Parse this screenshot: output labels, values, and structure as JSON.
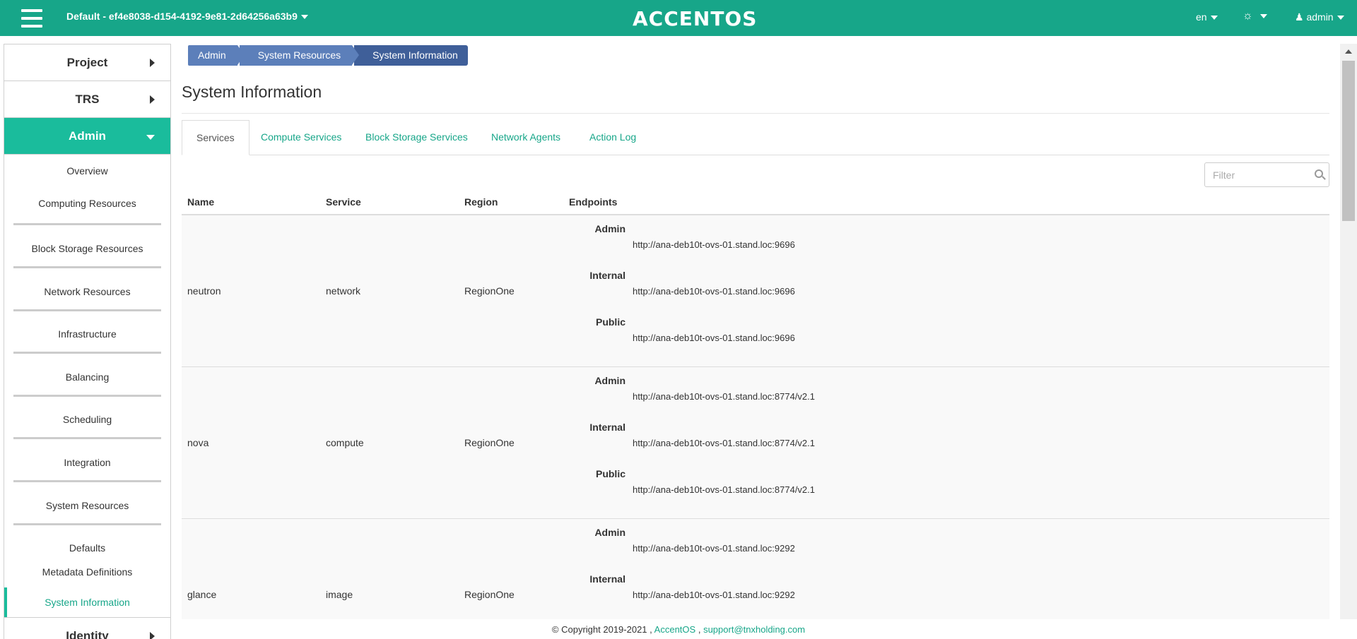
{
  "header": {
    "project_label": "Default - ef4e8038-d154-4192-9e81-2d64256a63b9",
    "brand": "ACCENTOS",
    "lang": "en",
    "user": "admin"
  },
  "sidebar": {
    "project": "Project",
    "trs": "TRS",
    "admin": "Admin",
    "identity": "Identity",
    "items": [
      "Overview",
      "Computing Resources",
      "Block Storage Resources",
      "Network Resources",
      "Infrastructure",
      "Balancing",
      "Scheduling",
      "Integration",
      "System Resources",
      "Defaults",
      "Metadata Definitions",
      "System Information"
    ]
  },
  "breadcrumb": [
    "Admin",
    "System Resources",
    "System Information"
  ],
  "page_title": "System Information",
  "tabs": [
    "Services",
    "Compute Services",
    "Block Storage Services",
    "Network Agents",
    "Action Log"
  ],
  "filter_placeholder": "Filter",
  "table": {
    "columns": [
      "Name",
      "Service",
      "Region",
      "Endpoints"
    ],
    "endpoint_labels": [
      "Admin",
      "Internal",
      "Public"
    ],
    "rows": [
      {
        "name": "neutron",
        "service": "network",
        "region": "RegionOne",
        "admin": "http://ana-deb10t-ovs-01.stand.loc:9696",
        "internal": "http://ana-deb10t-ovs-01.stand.loc:9696",
        "public": "http://ana-deb10t-ovs-01.stand.loc:9696"
      },
      {
        "name": "nova",
        "service": "compute",
        "region": "RegionOne",
        "admin": "http://ana-deb10t-ovs-01.stand.loc:8774/v2.1",
        "internal": "http://ana-deb10t-ovs-01.stand.loc:8774/v2.1",
        "public": "http://ana-deb10t-ovs-01.stand.loc:8774/v2.1"
      },
      {
        "name": "glance",
        "service": "image",
        "region": "RegionOne",
        "admin": "http://ana-deb10t-ovs-01.stand.loc:9292",
        "internal": "http://ana-deb10t-ovs-01.stand.loc:9292"
      }
    ]
  },
  "footer": {
    "copyright": "© Copyright 2019-2021 ,",
    "brand_link": "AccentOS",
    "separator": ",",
    "support_link": "support@tnxholding.com"
  },
  "colors": {
    "accent": "#17a689",
    "active_menu": "#1abc9c",
    "breadcrumb": "#5c7fba"
  }
}
